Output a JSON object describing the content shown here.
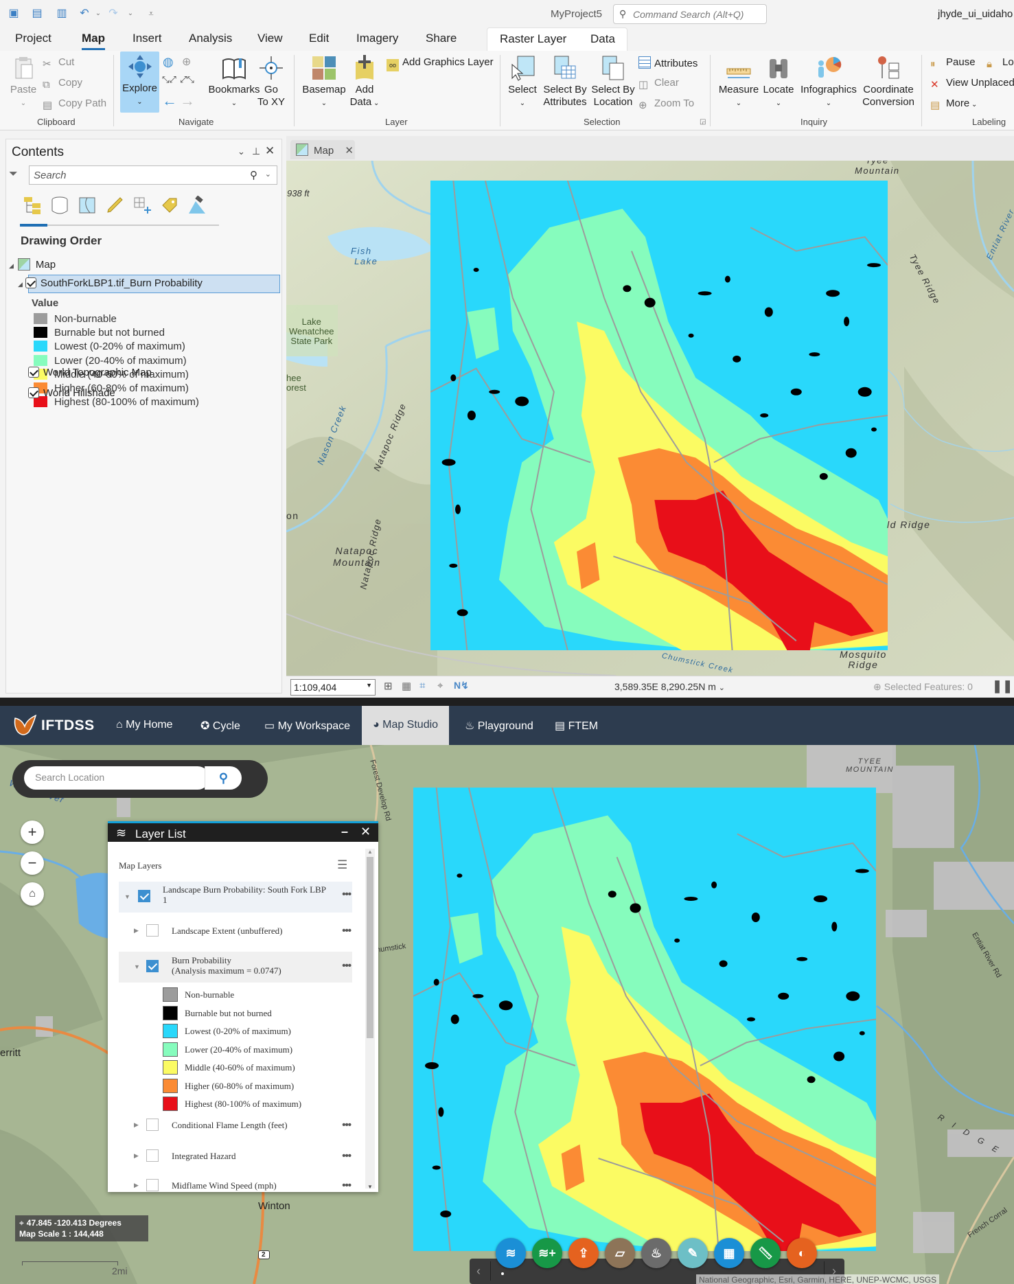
{
  "arcgis": {
    "quick_access": [
      "new-project-icon",
      "open-project-icon",
      "save-project-icon",
      "undo-icon",
      "redo-icon",
      "customize-icon"
    ],
    "app_title": "MyProject5",
    "command_search_placeholder": "Command Search (Alt+Q)",
    "user": "jhyde_ui_uidaho",
    "tabs": [
      "Project",
      "Map",
      "Insert",
      "Analysis",
      "View",
      "Edit",
      "Imagery",
      "Share"
    ],
    "active_tab": "Map",
    "context_tabs": [
      "Raster Layer",
      "Data"
    ],
    "ribbon": {
      "clipboard": {
        "group": "Clipboard",
        "paste": "Paste",
        "cut": "Cut",
        "copy": "Copy",
        "copy_path": "Copy Path"
      },
      "navigate": {
        "group": "Navigate",
        "explore": "Explore",
        "bookmarks": "Bookmarks",
        "go_to_xy_1": "Go",
        "go_to_xy_2": "To XY"
      },
      "layer": {
        "group": "Layer",
        "basemap": "Basemap",
        "add_data_1": "Add",
        "add_data_2": "Data",
        "add_graphics_layer": "Add Graphics Layer"
      },
      "selection": {
        "group": "Selection",
        "select": "Select",
        "select_by_attr_1": "Select By",
        "select_by_attr_2": "Attributes",
        "select_by_loc_1": "Select By",
        "select_by_loc_2": "Location",
        "attributes": "Attributes",
        "clear": "Clear",
        "zoom_to": "Zoom To"
      },
      "inquiry": {
        "group": "Inquiry",
        "measure": "Measure",
        "locate": "Locate",
        "infographics": "Infographics",
        "coord_conv_1": "Coordinate",
        "coord_conv_2": "Conversion"
      },
      "labeling": {
        "group": "Labeling",
        "pause": "Pause",
        "lock": "Lock",
        "view_unplaced": "View Unplaced",
        "more": "More"
      }
    },
    "contents": {
      "title": "Contents",
      "search_placeholder": "Search",
      "section": "Drawing Order",
      "map_node": "Map",
      "layer": "SouthForkLBP1.tif_Burn Probability",
      "value_header": "Value",
      "legend": [
        {
          "label": "Non-burnable",
          "color": "#9c9c9c"
        },
        {
          "label": "Burnable but not burned",
          "color": "#000000"
        },
        {
          "label": "Lowest (0-20% of maximum)",
          "color": "#29d8fb"
        },
        {
          "label": "Lower (20-40% of maximum)",
          "color": "#86fcbd"
        },
        {
          "label": "Middle (40-60% of maximum)",
          "color": "#fbfb63"
        },
        {
          "label": "Higher (60-80% of maximum)",
          "color": "#fb8b34"
        },
        {
          "label": "Highest (80-100% of maximum)",
          "color": "#e80f19"
        }
      ],
      "basemaps": [
        {
          "label": "World Topographic Map",
          "checked": true
        },
        {
          "label": "World Hillshade",
          "checked": true
        }
      ]
    },
    "map_tab": "Map",
    "map_labels": {
      "elev": "938 ft",
      "fish_lake_1": "Fish",
      "fish_lake_2": "Lake",
      "park_1": "Lake",
      "park_2": "Wenatchee",
      "park_3": "State Park",
      "forest_1": "hee",
      "forest_2": "orest",
      "nason": "Nason Creek",
      "natapoc_ridge": "Natapoc Ridge",
      "natapoc_mtn_1": "Natapoc",
      "natapoc_mtn_2": "Mountain",
      "on": "on",
      "tyee_mtn_1": "Tyee",
      "tyee_mtn_2": "Mountain",
      "tyee_ridge": "Tyee Ridge",
      "entiat": "Entiat River",
      "ridge": "ld Ridge",
      "mosquito_1": "Mosquito",
      "mosquito_2": "Ridge",
      "chumstick": "Chumstick Creek"
    },
    "status": {
      "scale": "1:109,404",
      "coordinates": "3,589.35E 8,290.25N m",
      "selected_features": "Selected Features: 0"
    }
  },
  "iftdss": {
    "logo": "IFTDSS",
    "nav": [
      {
        "label": "My Home",
        "icon": "home-icon"
      },
      {
        "label": "Cycle",
        "icon": "cycle-icon"
      },
      {
        "label": "My Workspace",
        "icon": "workspace-icon"
      },
      {
        "label": "Map Studio",
        "icon": "globe-icon",
        "active": true
      },
      {
        "label": "Playground",
        "icon": "fire-icon"
      },
      {
        "label": "FTEM",
        "icon": "clipboard-icon"
      }
    ],
    "search_placeholder": "Search Location",
    "layer_list": {
      "title": "Layer List",
      "section": "Map Layers",
      "group": {
        "label_1": "Landscape Burn Probability: South Fork LBP",
        "label_2": "1",
        "checked": true
      },
      "items": [
        {
          "label": "Landscape Extent (unbuffered)",
          "checked": false
        },
        {
          "label_1": "Burn Probability",
          "label_2": "(Analysis maximum = 0.0747)",
          "checked": true
        },
        {
          "label": "Conditional Flame Length (feet)",
          "checked": false
        },
        {
          "label": "Integrated Hazard",
          "checked": false
        },
        {
          "label": "Midflame Wind Speed (mph)",
          "checked": false
        }
      ],
      "legend": [
        {
          "label": "Non-burnable",
          "color": "#9c9c9c"
        },
        {
          "label": "Burnable but not burned",
          "color": "#000000"
        },
        {
          "label": "Lowest (0-20% of maximum)",
          "color": "#29d8fb"
        },
        {
          "label": "Lower (20-40% of maximum)",
          "color": "#86fcbd"
        },
        {
          "label": "Middle (40-60% of maximum)",
          "color": "#fbfb63"
        },
        {
          "label": "Higher (60-80% of maximum)",
          "color": "#fb8b34"
        },
        {
          "label": "Highest (80-100% of maximum)",
          "color": "#e80f19"
        }
      ]
    },
    "map_labels": {
      "white_river": "White River",
      "tyee_1": "TYEE",
      "tyee_2": "MOUNTAIN",
      "merritt": "erritt",
      "winton": "Winton",
      "hwy": "2",
      "ridge": "R I D G E",
      "entiat_rd": "Entiat River Rd",
      "french": "French Corral",
      "develop": "Forest Develop Rd",
      "chumstick": "humstick"
    },
    "coords": "47.845 -120.413 Degrees",
    "map_scale": "Map Scale 1 : 144,448",
    "scalebar": "2mi",
    "attribution": "National Geographic, Esri, Garmin, HERE, UNEP-WCMC, USGS",
    "toolbar": [
      {
        "name": "layers-tool",
        "color": "#1b8fd6"
      },
      {
        "name": "add-layer-tool",
        "color": "#179847"
      },
      {
        "name": "upload-tool",
        "color": "#e5621f"
      },
      {
        "name": "basemap-tool",
        "color": "#8d7458"
      },
      {
        "name": "fire-tool",
        "color": "#6b6b6b"
      },
      {
        "name": "draw-tool",
        "color": "#6dbfc6"
      },
      {
        "name": "grid-tool",
        "color": "#1b8fd6"
      },
      {
        "name": "measure-tool",
        "color": "#179847"
      },
      {
        "name": "style-tool",
        "color": "#e5621f"
      }
    ]
  }
}
